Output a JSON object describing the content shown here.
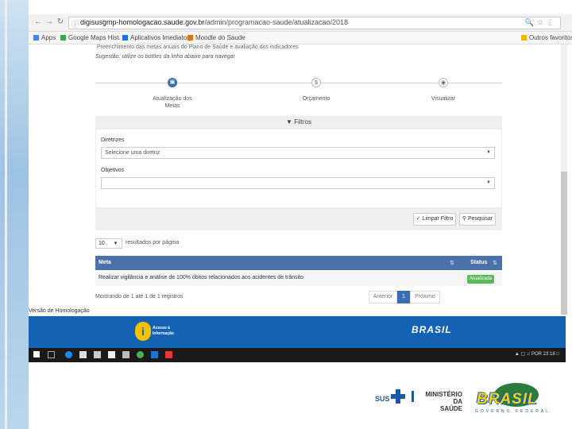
{
  "browser": {
    "url_host": "digisusgmp-homologacao.saude.gov.br",
    "url_path": "/admin/programacao-saude/atualizacao/2018",
    "bookmarks": [
      {
        "label": "Apps",
        "color": "#4285f4"
      },
      {
        "label": "Google Maps Hist.",
        "color": "#34a853"
      },
      {
        "label": "Aplicativos Imediatos",
        "color": "#1a73e8"
      },
      {
        "label": "Moodle do Saude",
        "color": "#e37400"
      },
      {
        "label": "Outros favoritos",
        "color": "#f4b400"
      }
    ]
  },
  "page": {
    "top_snippet": "Preenchimento das metas anuais do Plano de Saúde e avaliação dos indicadores",
    "hint": "Sugestão: utilize os botões da linha abaixo para navegar",
    "steps": [
      {
        "label": "Atualização dos Metas",
        "state": "active",
        "icon": "calendar-icon"
      },
      {
        "label": "Orçamento",
        "state": "inactive",
        "icon": "dollar-icon"
      },
      {
        "label": "Visualizar",
        "state": "inactive",
        "icon": "eye-icon"
      }
    ],
    "filters": {
      "title": "Filtros",
      "diretrizes_label": "Diretrizes",
      "diretrizes_value": "Selecione uma diretriz",
      "objetivos_label": "Objetivos",
      "objetivos_value": "",
      "clear_button": "Limpar Filtro",
      "search_button": "Pesquisar"
    },
    "per_page": {
      "value": "10",
      "label": "resultados por página"
    },
    "table": {
      "columns": [
        "Meta",
        "Status"
      ],
      "rows": [
        {
          "meta": "Realizar vigilância e análise de 100% óbitos relacionados aos acidentes de trânsito",
          "status": "Atualizada"
        }
      ]
    },
    "showing": "Mostrando de 1 até 1 de 1 registros",
    "pagination": {
      "prev": "Anterior",
      "current": "1",
      "next": "Próximo"
    },
    "homolog": "Versão de Homologação"
  },
  "site_footer": {
    "info_label_1": "Acesso à",
    "info_label_2": "Informação",
    "brand": "BRASIL"
  },
  "taskbar": {
    "tray_text": "POR  23:18"
  },
  "slide_logos": {
    "sus": "SUS",
    "ministerio_1": "MINISTÉRIO DA",
    "ministerio_2": "SAÚDE",
    "brasil": "BRASIL",
    "brasil_sub": "GOVERNO FEDERAL"
  },
  "colors": {
    "primary": "#3b6db2",
    "table_header": "#4a72a8",
    "status_green": "#5cb85c",
    "footer_blue": "#1462b3"
  }
}
